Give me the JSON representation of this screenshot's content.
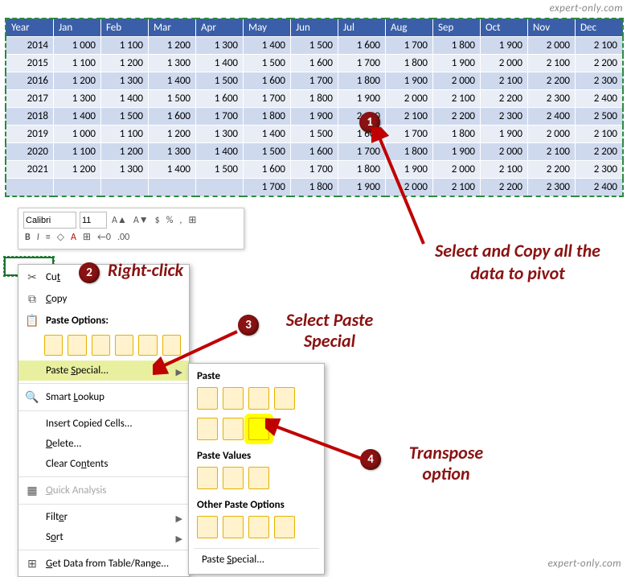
{
  "watermark_top": "expert-only.com",
  "watermark_bottom": "expert-only.com",
  "watermark_diag": "expert-only.com",
  "chart_data": {
    "type": "table",
    "title": "",
    "columns": [
      "Year",
      "Jan",
      "Feb",
      "Mar",
      "Apr",
      "May",
      "Jun",
      "Jul",
      "Aug",
      "Sep",
      "Oct",
      "Nov",
      "Dec"
    ],
    "rows": [
      [
        "2014",
        "1 000",
        "1 100",
        "1 200",
        "1 300",
        "1 400",
        "1 500",
        "1 600",
        "1 700",
        "1 800",
        "1 900",
        "2 000",
        "2 100"
      ],
      [
        "2015",
        "1 100",
        "1 200",
        "1 300",
        "1 400",
        "1 500",
        "1 600",
        "1 700",
        "1 800",
        "1 900",
        "2 000",
        "2 100",
        "2 200"
      ],
      [
        "2016",
        "1 200",
        "1 300",
        "1 400",
        "1 500",
        "1 600",
        "1 700",
        "1 800",
        "1 900",
        "2 000",
        "2 100",
        "2 200",
        "2 300"
      ],
      [
        "2017",
        "1 300",
        "1 400",
        "1 500",
        "1 600",
        "1 700",
        "1 800",
        "1 900",
        "2 000",
        "2 100",
        "2 200",
        "2 300",
        "2 400"
      ],
      [
        "2018",
        "1 400",
        "1 500",
        "1 600",
        "1 700",
        "1 800",
        "1 900",
        "2 000",
        "2 100",
        "2 200",
        "2 300",
        "2 400",
        "2 500"
      ],
      [
        "2019",
        "1 000",
        "1 100",
        "1 200",
        "1 300",
        "1 400",
        "1 500",
        "1 600",
        "1 700",
        "1 800",
        "1 900",
        "2 000",
        "2 100"
      ],
      [
        "2020",
        "1 100",
        "1 200",
        "1 300",
        "1 400",
        "1 500",
        "1 600",
        "1 700",
        "1 800",
        "1 900",
        "2 000",
        "2 100",
        "2 200"
      ],
      [
        "2021",
        "1 200",
        "1 300",
        "1 400",
        "1 500",
        "1 600",
        "1 700",
        "1 800",
        "1 900",
        "2 000",
        "2 100",
        "2 200",
        "2 300"
      ],
      [
        "",
        "",
        "",
        "",
        "",
        "1 700",
        "1 800",
        "1 900",
        "2 000",
        "2 100",
        "2 200",
        "2 300",
        "2 400"
      ]
    ]
  },
  "mini_toolbar": {
    "font": "Calibri",
    "size": "11",
    "buttons_row1": [
      "A▲",
      "A▼",
      "$",
      "%",
      ",",
      "⊞"
    ],
    "buttons_row2": [
      "B",
      "I",
      "≡",
      "◇",
      "A",
      "⊞",
      "←0",
      ".00"
    ]
  },
  "context_menu": {
    "cut": "Cut",
    "copy": "Copy",
    "paste_options_hdr": "Paste Options:",
    "paste_special": "Paste Special...",
    "smart_lookup": "Smart Lookup",
    "insert_copied": "Insert Copied Cells...",
    "delete": "Delete...",
    "clear": "Clear Contents",
    "quick_analysis": "Quick Analysis",
    "filter": "Filter",
    "sort": "Sort",
    "get_data": "Get Data from Table/Range..."
  },
  "paste_submenu": {
    "hdr_paste": "Paste",
    "hdr_values": "Paste Values",
    "hdr_other": "Other Paste Options",
    "paste_special": "Paste Special..."
  },
  "annotations": {
    "a1_text": "Select and Copy all the data to pivot",
    "a2_text": "Right-click",
    "a3_text": "Select Paste Special",
    "a4_text": "Transpose option",
    "n1": "1",
    "n2": "2",
    "n3": "3",
    "n4": "4"
  }
}
